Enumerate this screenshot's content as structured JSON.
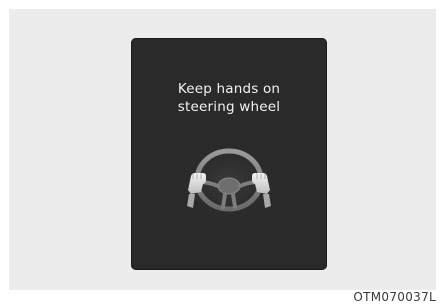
{
  "display": {
    "message_line1": "Keep hands on",
    "message_line2": "steering wheel",
    "icon": "steering-wheel-hands-icon"
  },
  "figure_code": "OTM070037L",
  "colors": {
    "display_background": "#2a2a2a",
    "message_text": "#f2f2f2",
    "panel_background": "#ececec"
  }
}
